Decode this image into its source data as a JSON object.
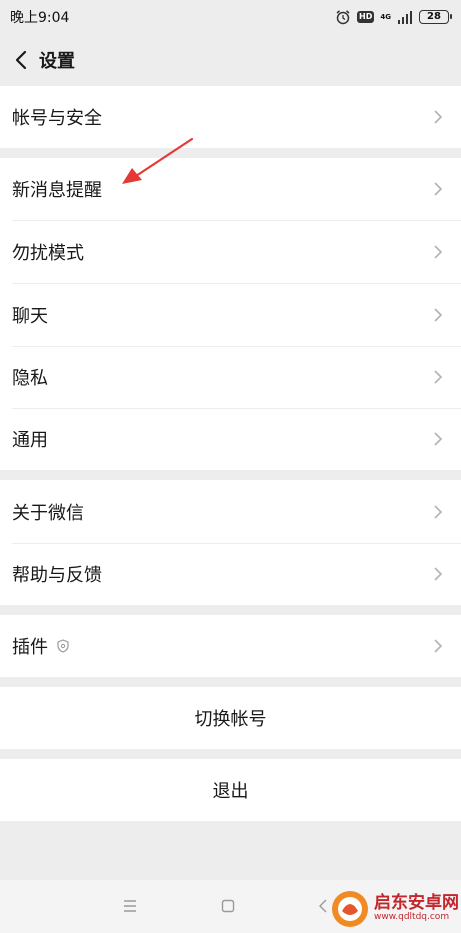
{
  "status_bar": {
    "time": "晚上9:04",
    "hd": "HD",
    "network": "4G",
    "battery": "28"
  },
  "header": {
    "title": "设置"
  },
  "menu": {
    "account_security": "帐号与安全",
    "new_message_alerts": "新消息提醒",
    "do_not_disturb": "勿扰模式",
    "chat": "聊天",
    "privacy": "隐私",
    "general": "通用",
    "about_wechat": "关于微信",
    "help_feedback": "帮助与反馈",
    "plugins": "插件"
  },
  "actions": {
    "switch_account": "切换帐号",
    "logout": "退出"
  },
  "watermark": {
    "name": "启东安卓网",
    "url": "www.qdltdq.com"
  },
  "colors": {
    "background": "#ededed",
    "row": "#ffffff",
    "annotation_arrow": "#e53935",
    "watermark": "#c1272d"
  }
}
